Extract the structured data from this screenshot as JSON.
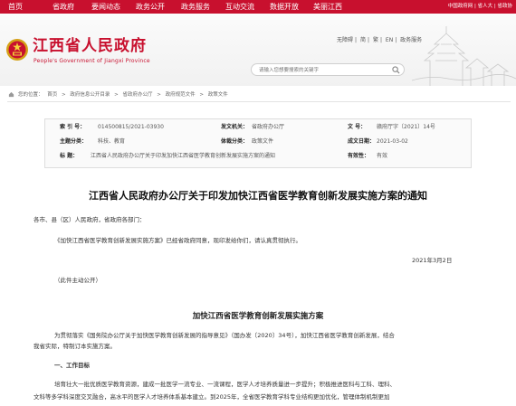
{
  "nav": {
    "items": [
      "首页",
      "省政府",
      "要闻动态",
      "政务公开",
      "政务服务",
      "互动交流",
      "数据开放",
      "美丽江西"
    ],
    "utility": "中国政府网 | 省人大 | 省政协"
  },
  "header": {
    "title": "江西省人民政府",
    "subtitle": "People's Government of Jiangxi Province",
    "links": [
      "无障碍",
      "简",
      "繁",
      "EN",
      "政务服务"
    ],
    "search_placeholder": "请输入您想要搜索的关键字"
  },
  "breadcrumb": {
    "prefix": "您的位置：",
    "items": [
      "首页",
      "政府信息公开目录",
      "省政府办公厅",
      "政府规范文件",
      "政策文件"
    ],
    "separator": ">"
  },
  "meta": {
    "index_label": "索  引  号：",
    "index_value": "014500815/2021-03930",
    "issuer_label": "发文机关：",
    "issuer_value": "省政府办公厅",
    "docno_label": "文       号：",
    "docno_value": "赣府厅字〔2021〕14号",
    "topic_label": "主题分类：",
    "topic_value": "科技、教育",
    "type_label": "体裁分类：",
    "type_value": "政策文件",
    "date_label": "成文日期：",
    "date_value": "2021-03-02",
    "subject_label": "标       题：",
    "subject_value": "江西省人民政府办公厅关于印发加快江西省医学教育创新发展实施方案的通知",
    "validity_label": "有效性：",
    "validity_value": "有效"
  },
  "article": {
    "title": "江西省人民政府办公厅关于印发加快江西省医学教育创新发展实施方案的通知",
    "salutation": "各市、县（区）人民政府，省政府各部门：",
    "body1": "《加快江西省医学教育创新发展实施方案》已经省政府同意，现印发给你们，请认真贯彻执行。",
    "date": "2021年3月2日",
    "note": "（此件主动公开）",
    "plan_title": "加快江西省医学教育创新发展实施方案",
    "plan_intro_1": "为贯彻落实《国务院办公厅关于加快医学教育创新发展的指导意见》（国办发〔2020〕34号），加快江西省医学教育创新发展，结合",
    "plan_intro_2": "我省实际，特制订本实施方案。",
    "section1": "一、工作目标",
    "goal_1": "培育壮大一批优质医学教育资源，建成一批医学一流专业、一流课程，医学人才培养质量进一步提升；积极推进医科与工科、理科、",
    "goal_2": "文科等多学科深度交叉融合，高水平的医学人才培养体系基本建立。到2025年，全省医学教育学科专业结构更加优化，管理体制机制更加"
  },
  "colors": {
    "brand_red": "#c8102e",
    "meta_bg": "#fafafa",
    "border": "#dddddd"
  },
  "icons": {
    "emblem": "national-emblem-icon",
    "search": "search-icon",
    "home": "home-icon"
  }
}
